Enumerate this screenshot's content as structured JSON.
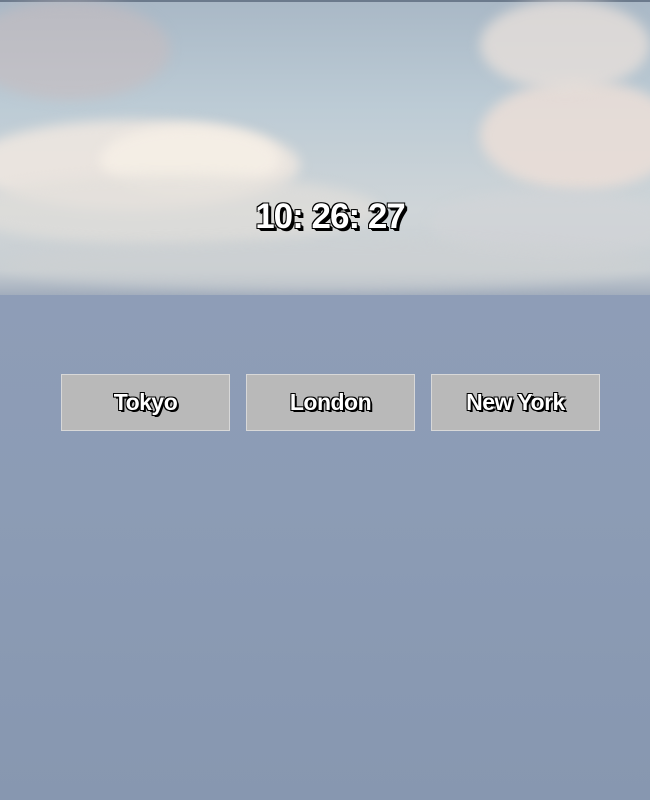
{
  "clock": {
    "time": "10: 26: 27"
  },
  "cities": {
    "tokyo": "Tokyo",
    "london": "London",
    "new_york": "New York"
  },
  "colors": {
    "sky": "#bccbd5",
    "ground": "#8c9cb5",
    "button_bg": "#b9b9b9",
    "text": "#ffffff",
    "text_outline": "#000000"
  }
}
